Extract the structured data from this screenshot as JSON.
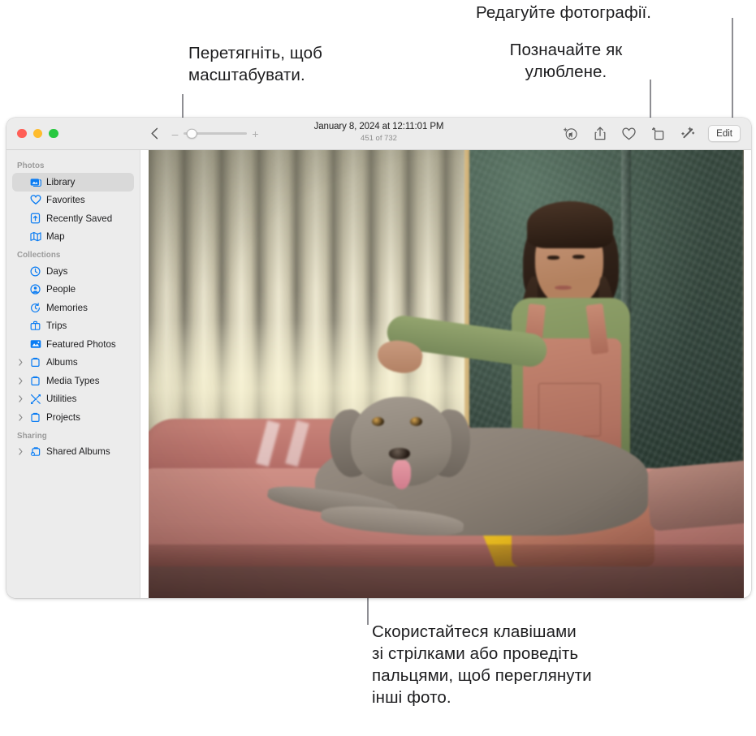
{
  "callouts": {
    "zoom": "Перетягніть, щоб\nмасштабувати.",
    "edit": "Редагуйте фотографії.",
    "favorite": "Позначайте як\nулюблене.",
    "arrows": "Скористайтеся клавішами\nзі стрілками або проведіть\nпальцями, щоб переглянути\nінші фото."
  },
  "window": {
    "traffic_lights": {
      "close": "close-button",
      "minimize": "minimize-button",
      "zoom": "zoom-button"
    }
  },
  "toolbar": {
    "back_icon": "chevron-left-icon",
    "zoom_out_label": "–",
    "zoom_in_label": "+",
    "zoom_slider_value": 12,
    "title_date": "January 8, 2024 at 12:11:01 PM",
    "title_count": "451 of 732",
    "actions": [
      {
        "name": "identify-pet-icon",
        "label": "Identify Pet"
      },
      {
        "name": "share-icon",
        "label": "Share"
      },
      {
        "name": "heart-icon",
        "label": "Favorite"
      },
      {
        "name": "rotate-icon",
        "label": "Rotate"
      },
      {
        "name": "magic-wand-icon",
        "label": "Auto Enhance"
      }
    ],
    "edit_label": "Edit"
  },
  "sidebar": {
    "sections": [
      {
        "header": "Photos",
        "items": [
          {
            "label": "Library",
            "icon": "library-icon",
            "selected": true,
            "disclosure": false
          },
          {
            "label": "Favorites",
            "icon": "heart-icon",
            "selected": false,
            "disclosure": false
          },
          {
            "label": "Recently Saved",
            "icon": "recently-saved-icon",
            "selected": false,
            "disclosure": false
          },
          {
            "label": "Map",
            "icon": "map-icon",
            "selected": false,
            "disclosure": false
          }
        ]
      },
      {
        "header": "Collections",
        "items": [
          {
            "label": "Days",
            "icon": "clock-icon",
            "selected": false,
            "disclosure": false
          },
          {
            "label": "People",
            "icon": "person-icon",
            "selected": false,
            "disclosure": false
          },
          {
            "label": "Memories",
            "icon": "memories-icon",
            "selected": false,
            "disclosure": false
          },
          {
            "label": "Trips",
            "icon": "trips-icon",
            "selected": false,
            "disclosure": false
          },
          {
            "label": "Featured Photos",
            "icon": "featured-photos-icon",
            "selected": false,
            "disclosure": false
          },
          {
            "label": "Albums",
            "icon": "folder-icon",
            "selected": false,
            "disclosure": true
          },
          {
            "label": "Media Types",
            "icon": "folder-icon",
            "selected": false,
            "disclosure": true
          },
          {
            "label": "Utilities",
            "icon": "utilities-icon",
            "selected": false,
            "disclosure": true
          },
          {
            "label": "Projects",
            "icon": "folder-icon",
            "selected": false,
            "disclosure": true
          }
        ]
      },
      {
        "header": "Sharing",
        "items": [
          {
            "label": "Shared Albums",
            "icon": "shared-albums-icon",
            "selected": false,
            "disclosure": true
          }
        ]
      }
    ]
  },
  "photo": {
    "description": "Girl with braids in green shirt and rust corduroy overalls sitting on a pink sofa petting a grey Weimaraner dog, yellow blanket, vertical blinds and green damask wall behind."
  },
  "colors": {
    "accent": "#0a7cf3",
    "sidebar_bg": "#ececec",
    "selected_row": "#d9d9d9",
    "callout_text": "#1d1d1f",
    "leader_line": "#8e8e93"
  }
}
